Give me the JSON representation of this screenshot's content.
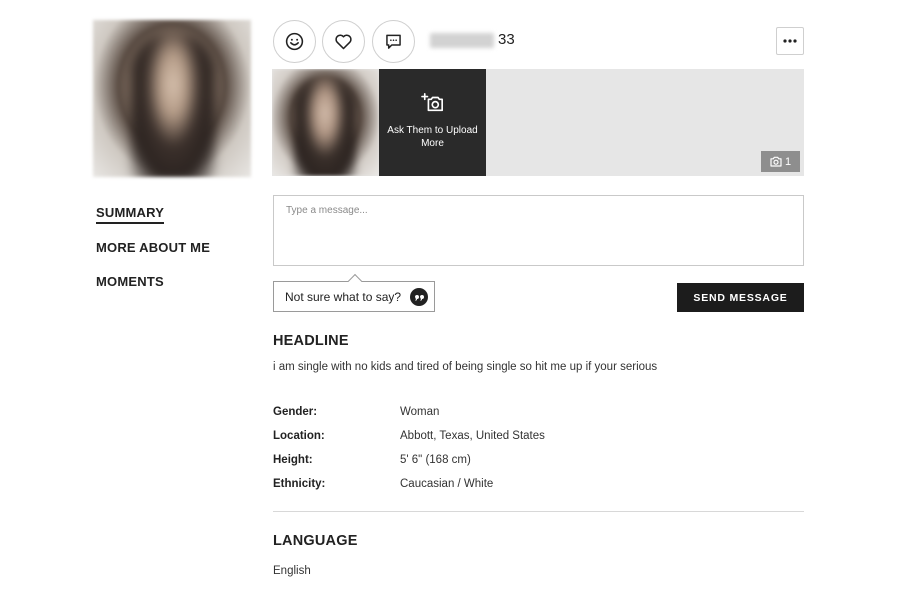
{
  "profile": {
    "age": "33",
    "photo_count": "1"
  },
  "actions": {
    "wink_icon": "smiley-face-icon",
    "like_icon": "heart-icon",
    "message_icon": "chat-bubble-icon",
    "more_icon": "ellipsis-icon"
  },
  "photos": {
    "upload_cta_label": "Ask Them to Upload More",
    "count_icon": "camera-icon"
  },
  "nav": {
    "items": [
      {
        "label": "SUMMARY",
        "active": true
      },
      {
        "label": "MORE ABOUT ME",
        "active": false
      },
      {
        "label": "MOMENTS",
        "active": false
      }
    ]
  },
  "message": {
    "placeholder": "Type a message...",
    "suggestion_label": "Not sure what to say?",
    "send_label": "SEND MESSAGE"
  },
  "headline": {
    "title": "HEADLINE",
    "text": "i am single with no kids and tired of being single so hit me up if your serious"
  },
  "details": [
    {
      "label": "Gender:",
      "value": "Woman"
    },
    {
      "label": "Location:",
      "value": "Abbott, Texas, United States"
    },
    {
      "label": "Height:",
      "value": "5' 6\" (168 cm)"
    },
    {
      "label": "Ethnicity:",
      "value": "Caucasian / White"
    }
  ],
  "language": {
    "title": "LANGUAGE",
    "value": "English"
  },
  "colors": {
    "primary_button": "#1c1c1c",
    "strip_background": "#e6e6e6",
    "cta_background": "#2a2a2a",
    "border": "#cfcfcf"
  }
}
